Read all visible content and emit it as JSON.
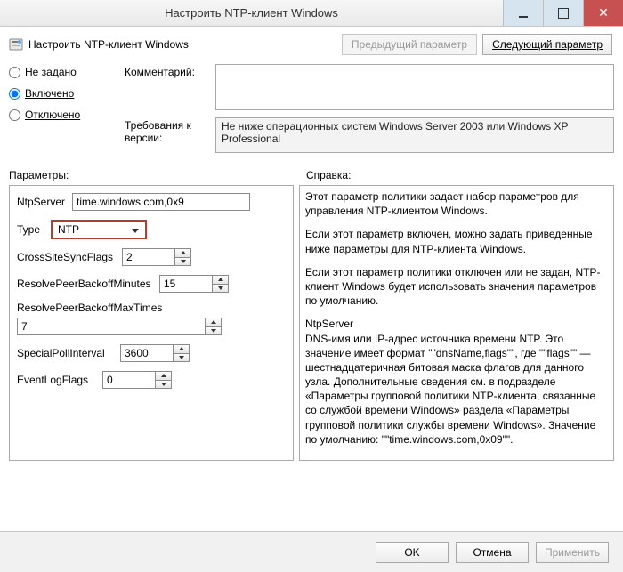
{
  "window": {
    "title": "Настроить NTP-клиент Windows"
  },
  "header": {
    "policy_title": "Настроить NTP-клиент Windows",
    "prev_button": "Предыдущий параметр",
    "next_button": "Следующий параметр"
  },
  "state": {
    "not_configured": "Не задано",
    "enabled": "Включено",
    "disabled": "Отключено",
    "selected": "enabled"
  },
  "comment": {
    "label": "Комментарий:",
    "value": ""
  },
  "requirements": {
    "label": "Требования к версии:",
    "text": "Не ниже операционных систем Windows Server 2003 или Windows XP Professional"
  },
  "sections": {
    "options_label": "Параметры:",
    "help_label": "Справка:"
  },
  "options": {
    "ntpserver_label": "NtpServer",
    "ntpserver_value": "time.windows.com,0x9",
    "type_label": "Type",
    "type_value": "NTP",
    "crosssite_label": "CrossSiteSyncFlags",
    "crosssite_value": "2",
    "resolvemin_label": "ResolvePeerBackoffMinutes",
    "resolvemin_value": "15",
    "resolvemax_label": "ResolvePeerBackoffMaxTimes",
    "resolvemax_value": "7",
    "specialpoll_label": "SpecialPollInterval",
    "specialpoll_value": "3600",
    "eventlog_label": "EventLogFlags",
    "eventlog_value": "0"
  },
  "help": {
    "p1": "Этот параметр политики задает набор параметров для управления NTP-клиентом Windows.",
    "p2": "Если этот параметр включен, можно задать приведенные ниже параметры для NTP-клиента Windows.",
    "p3": "Если этот параметр политики отключен или не задан, NTP-клиент Windows будет использовать значения параметров по умолчанию.",
    "p4_title": "NtpServer",
    "p4": "DNS-имя или IP-адрес источника времени NTP. Это значение имеет формат \"\"dnsName,flags\"\", где \"\"flags\"\" — шестнадцатеричная битовая маска флагов для данного узла. Дополнительные сведения см. в подразделе «Параметры групповой политики NTP-клиента, связанные со службой времени Windows» раздела «Параметры групповой политики службы времени Windows».   Значение по умолчанию: \"\"time.windows.com,0x09\"\"."
  },
  "footer": {
    "ok": "OK",
    "cancel": "Отмена",
    "apply": "Применить"
  }
}
